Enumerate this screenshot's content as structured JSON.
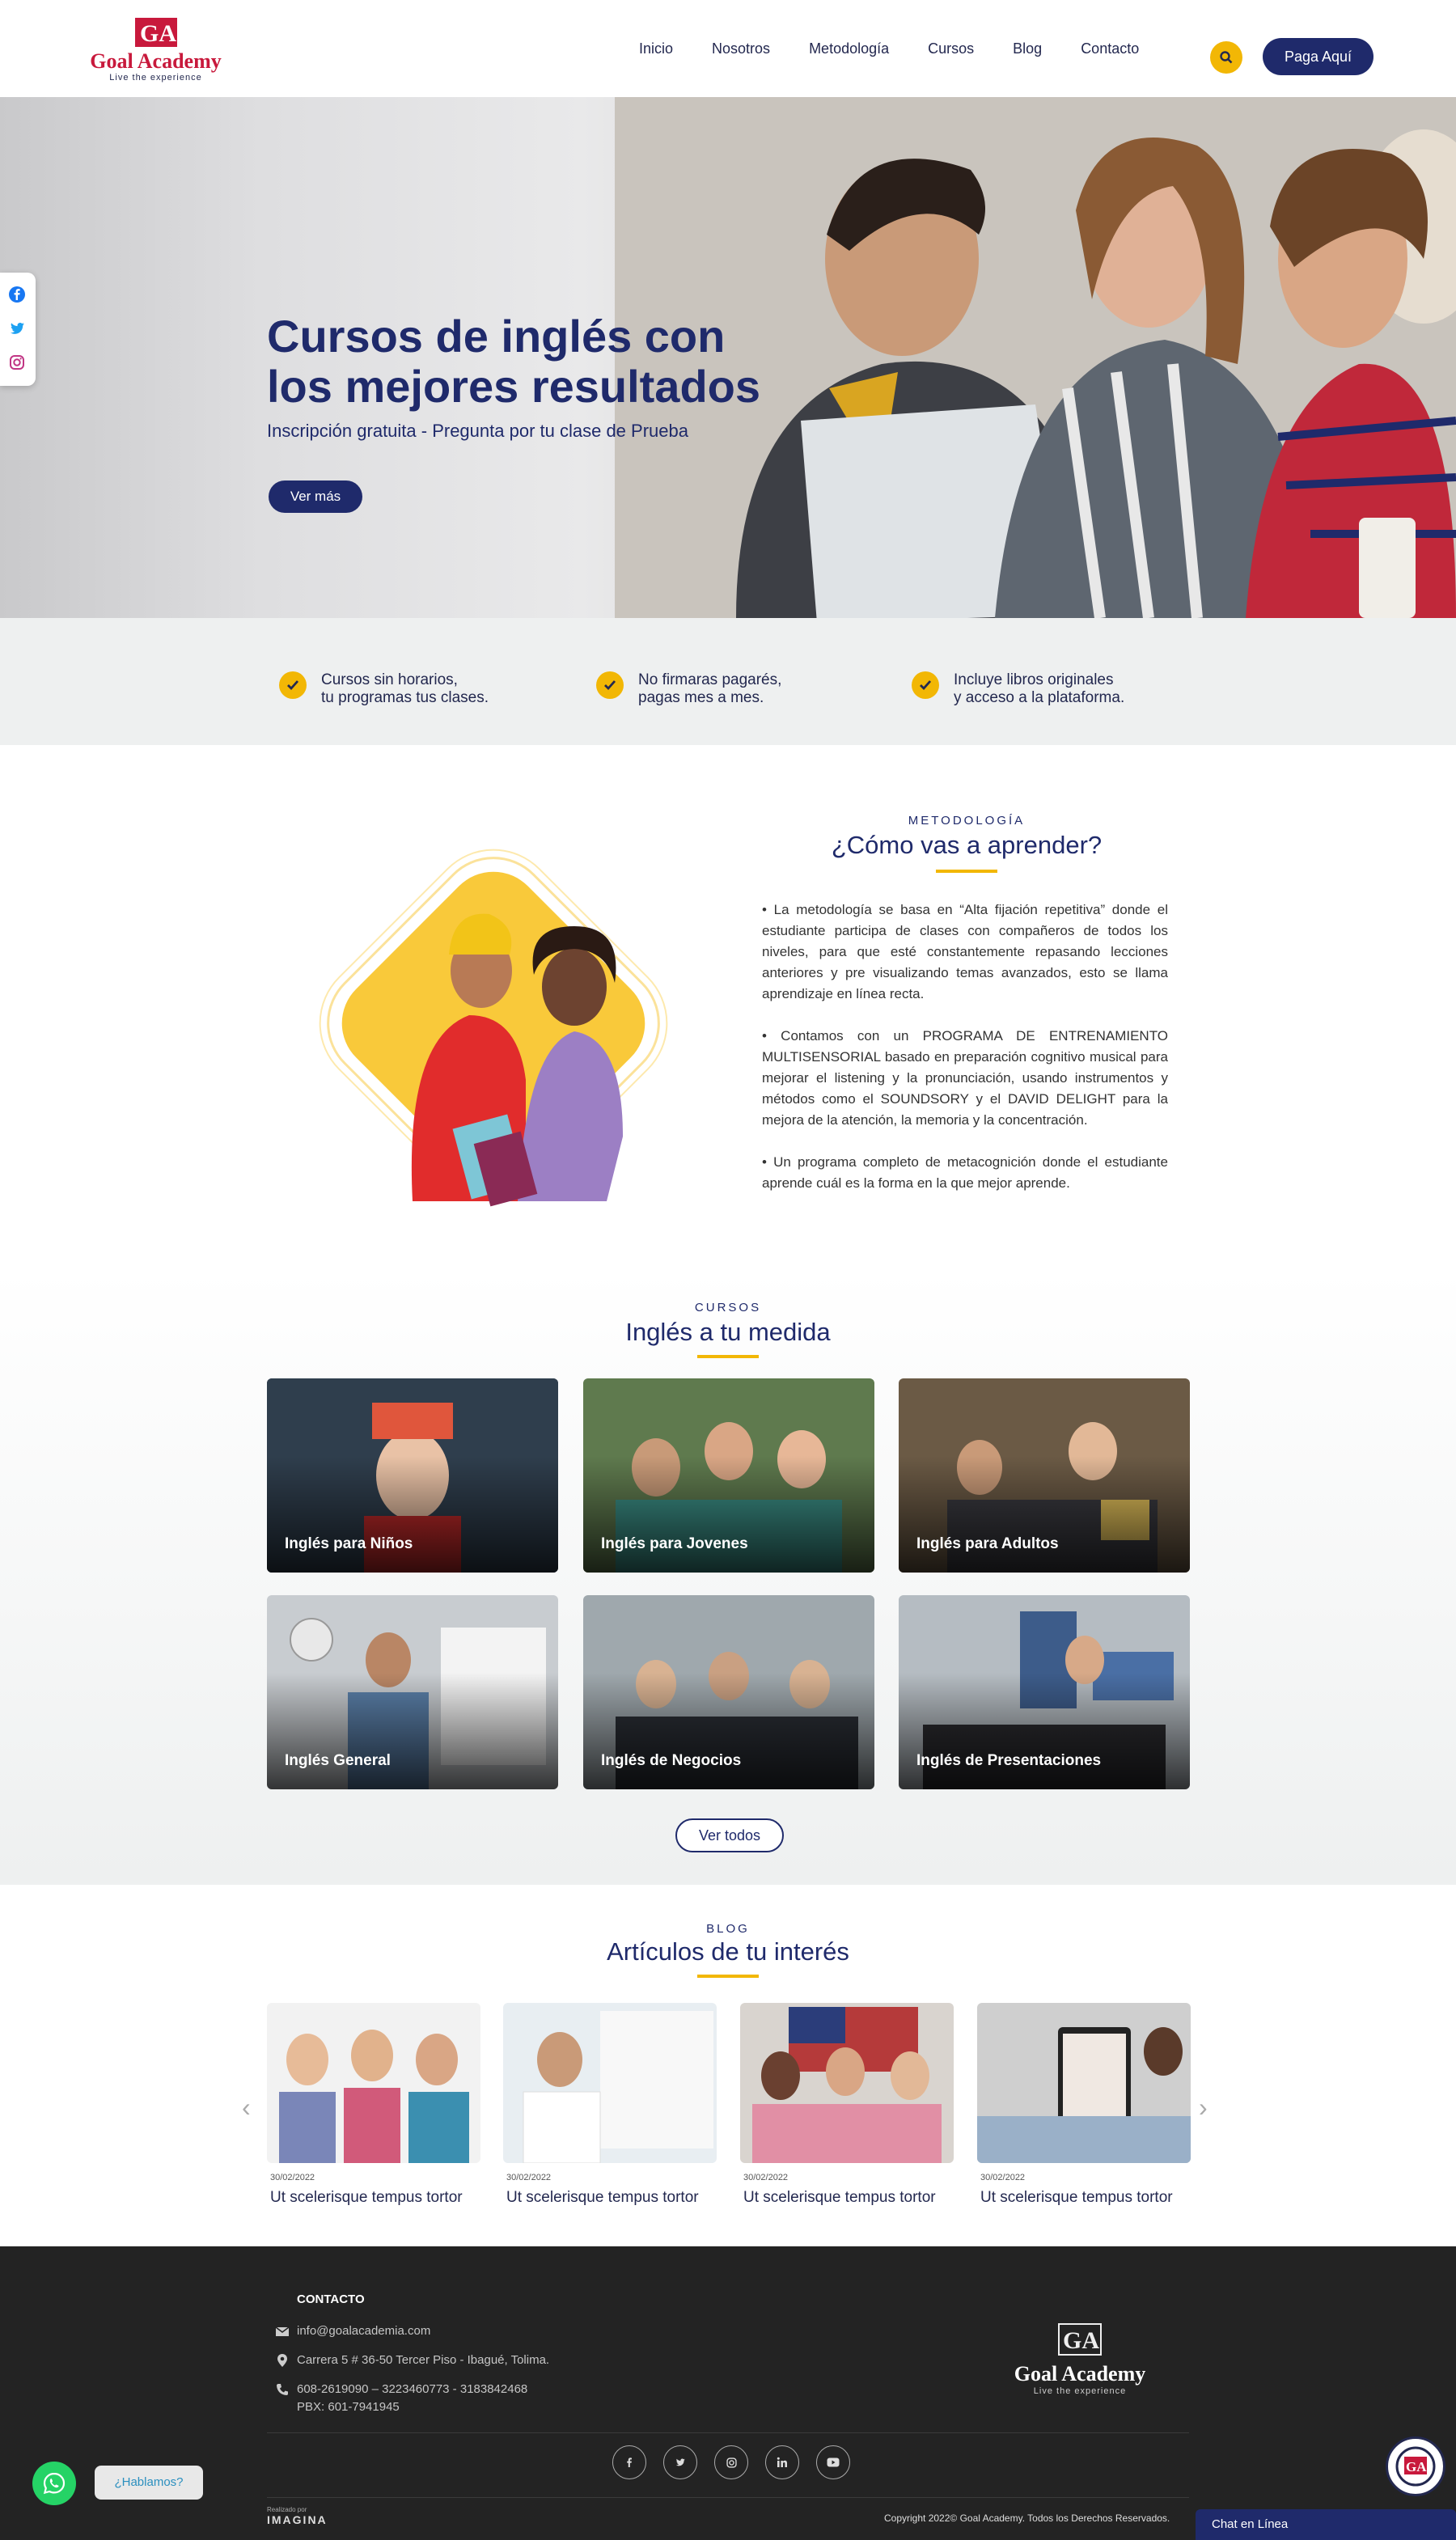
{
  "header": {
    "logo_title": "Goal Academy",
    "logo_tagline": "Live the experience",
    "nav": [
      "Inicio",
      "Nosotros",
      "Metodología",
      "Cursos",
      "Blog",
      "Contacto"
    ],
    "pay_label": "Paga Aquí",
    "search_icon": "search-icon"
  },
  "hero": {
    "title": "Cursos de inglés con los mejores resultados",
    "subtitle": "Inscripción gratuita - Pregunta por tu clase de Prueba",
    "button": "Ver más"
  },
  "social_tab": [
    "facebook-icon",
    "twitter-icon",
    "instagram-icon"
  ],
  "benefits": [
    {
      "line1": "Cursos sin horarios,",
      "line2": "tu programas tus clases."
    },
    {
      "line1": "No firmaras pagarés,",
      "line2": "pagas mes a mes."
    },
    {
      "line1": "Incluye libros originales",
      "line2": "y acceso a la plataforma."
    }
  ],
  "methodology": {
    "eyebrow": "METODOLOGÍA",
    "title": "¿Cómo vas a aprender?",
    "paragraphs": [
      "• La metodología se basa en “Alta fijación repetitiva” donde el estudiante participa de clases con compañeros de todos los niveles, para que esté constantemente repasando lecciones anteriores y pre visualizando temas avanzados, esto se llama aprendizaje en línea recta.",
      "• Contamos con un PROGRAMA DE ENTRENAMIENTO MULTISENSORIAL basado en preparación cognitivo musical para mejorar el listening y la pronunciación, usando instrumentos y métodos como el SOUNDSORY y el DAVID DELIGHT para la mejora de la atención, la memoria y la concentración.",
      "• Un programa completo de metacognición donde el estudiante aprende cuál es la forma en la que mejor aprende."
    ]
  },
  "courses": {
    "eyebrow": "CURSOS",
    "title": "Inglés a tu medida",
    "items": [
      "Inglés para Niños",
      "Inglés para Jovenes",
      "Inglés para Adultos",
      "Inglés General",
      "Inglés de Negocios",
      "Inglés de Presentaciones"
    ],
    "see_all": "Ver todos"
  },
  "blog": {
    "eyebrow": "BLOG",
    "title": "Artículos de tu interés",
    "posts": [
      {
        "date": "30/02/2022",
        "title": "Ut scelerisque tempus tortor"
      },
      {
        "date": "30/02/2022",
        "title": "Ut scelerisque tempus tortor"
      },
      {
        "date": "30/02/2022",
        "title": "Ut scelerisque tempus tortor"
      },
      {
        "date": "30/02/2022",
        "title": "Ut scelerisque tempus tortor"
      }
    ]
  },
  "footer": {
    "heading": "CONTACTO",
    "email": "info@goalacademia.com",
    "address": "Carrera 5 # 36-50 Tercer Piso - Ibagué, Tolima.",
    "phone": "608-2619090 – 3223460773 - 3183842468",
    "pbx": "PBX: 601-7941945",
    "logo_title": "Goal Academy",
    "logo_tagline": "Live the experience",
    "social": [
      "facebook-icon",
      "twitter-icon",
      "instagram-icon",
      "linkedin-icon",
      "youtube-icon"
    ],
    "copyright": "Copyright 2022© Goal Academy. Todos los Derechos Reservados.",
    "made_by_label": "Realizado por",
    "made_by": "IMAGINA"
  },
  "whatsapp": {
    "bubble": "¿Hablamos?"
  },
  "chat": {
    "label": "Chat en Línea"
  },
  "colors": {
    "primary": "#1f2a6b",
    "accent": "#f2b705",
    "brand_red": "#c8193c",
    "footer_bg": "#232323"
  }
}
